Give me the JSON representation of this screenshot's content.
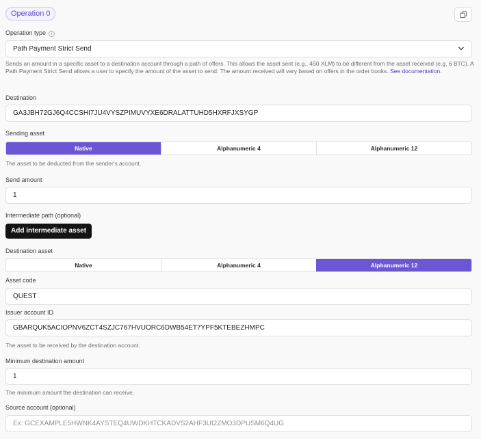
{
  "operation": {
    "badge": "Operation 0"
  },
  "operation_type": {
    "label": "Operation type",
    "value": "Path Payment Strict Send",
    "description": "Sends an amount in a specific asset to a destination account through a path of offers. This allows the asset sent (e.g., 450 XLM) to be different from the asset received (e.g, 6 BTC). A Path Payment Strict Send allows a user to specify the amount of the asset to send. The amount received will vary based on offers in the order books.",
    "doc_link": "See documentation."
  },
  "destination": {
    "label": "Destination",
    "value": "GA3JBH72GJ6Q4CCSHI7JU4VYSZPIMUVYXE6DRALATTUHD5HXRFJXSYGP"
  },
  "sending_asset": {
    "label": "Sending asset",
    "options": [
      "Native",
      "Alphanumeric 4",
      "Alphanumeric 12"
    ],
    "selected": "Native",
    "hint": "The asset to be deducted from the sender's account."
  },
  "send_amount": {
    "label": "Send amount",
    "value": "1"
  },
  "intermediate_path": {
    "label": "Intermediate path (optional)",
    "button": "Add intermediate asset"
  },
  "destination_asset": {
    "label": "Destination asset",
    "options": [
      "Native",
      "Alphanumeric 4",
      "Alphanumeric 12"
    ],
    "selected": "Alphanumeric 12"
  },
  "asset_code": {
    "label": "Asset code",
    "value": "QUEST"
  },
  "issuer": {
    "label": "Issuer account ID",
    "value": "GBARQUK5ACIOPNV6ZCT4SZJC767HVUORC6DWB54ET7YPF5KTEBEZHMPC",
    "hint": "The asset to be received by the destination account."
  },
  "min_dest_amount": {
    "label": "Minimum destination amount",
    "value": "1",
    "hint": "The minimum amount the destination can receive."
  },
  "source_account": {
    "label": "Source account (optional)",
    "placeholder": "Ex: GCEXAMPLE5HWNK4AYSTEQ4UWDKHTCKADVS2AHF3UI2ZMO3DPUSM6Q4UG"
  },
  "colors": {
    "accent": "#6c56d4",
    "link": "#4b39c0",
    "dark_button": "#141414"
  },
  "icons": [
    "copy-icon",
    "info-icon",
    "chevron-down-icon"
  ]
}
